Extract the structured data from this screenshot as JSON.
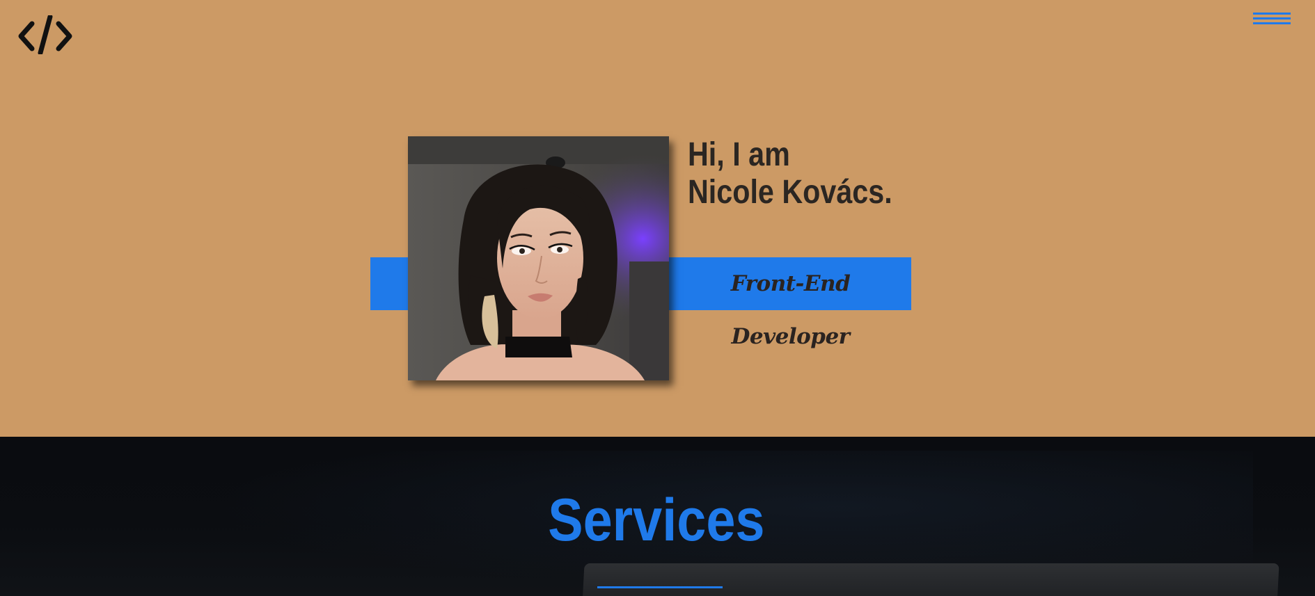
{
  "header": {
    "logo_icon": "code-brackets-icon",
    "menu_icon": "hamburger-menu-icon"
  },
  "hero": {
    "greeting_line1": "Hi, I am",
    "greeting_line2": "Nicole Kovács.",
    "role": "Front-End Developer",
    "photo_alt": "Portrait of Nicole Kovács"
  },
  "services": {
    "title": "Services"
  },
  "colors": {
    "hero_bg": "#cc9a65",
    "accent": "#1f7aea",
    "text_dark": "#2b2622",
    "services_bg": "#0a0c10"
  }
}
